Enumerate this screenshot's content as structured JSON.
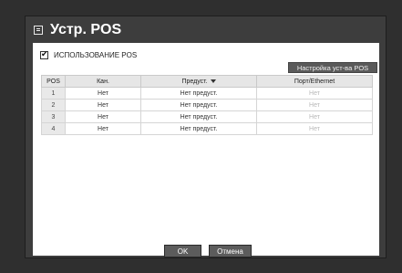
{
  "dialog": {
    "title": "Устр. POS",
    "use_pos_label": "ИСПОЛЬЗОВАНИЕ POS",
    "use_pos_checked": true,
    "setup_button": "Настройка уст-ва POS"
  },
  "table": {
    "headers": [
      "POS",
      "Кан.",
      "Предуст.",
      "Порт/Ethernet"
    ],
    "rows": [
      {
        "pos": "1",
        "channel": "Нет",
        "preset": "Нет предуст.",
        "port": "Нет"
      },
      {
        "pos": "2",
        "channel": "Нет",
        "preset": "Нет предуст.",
        "port": "Нет"
      },
      {
        "pos": "3",
        "channel": "Нет",
        "preset": "Нет предуст.",
        "port": "Нет"
      },
      {
        "pos": "4",
        "channel": "Нет",
        "preset": "Нет предуст.",
        "port": "Нет"
      }
    ]
  },
  "footer": {
    "ok": "OK",
    "cancel": "Отмена"
  }
}
